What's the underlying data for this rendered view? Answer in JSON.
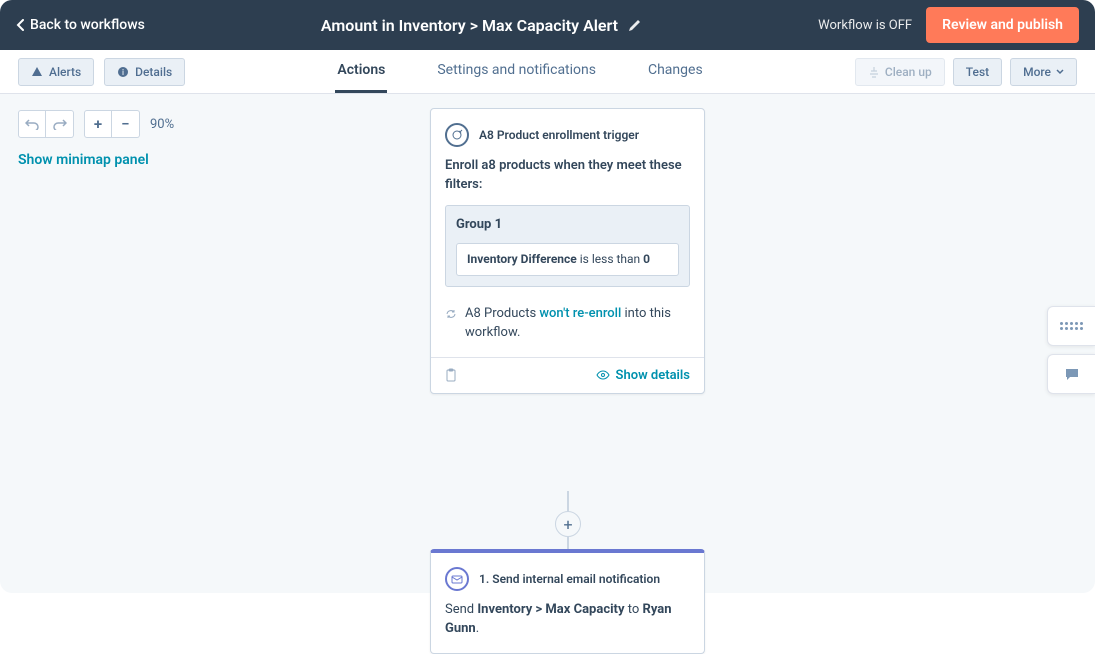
{
  "topbar": {
    "back": "Back to workflows",
    "title": "Amount in Inventory > Max Capacity Alert",
    "status": "Workflow is OFF",
    "review": "Review and publish"
  },
  "nav": {
    "alerts": "Alerts",
    "details": "Details",
    "tabs": {
      "actions": "Actions",
      "settings": "Settings and notifications",
      "changes": "Changes"
    },
    "cleanup": "Clean up",
    "test": "Test",
    "more": "More"
  },
  "tools": {
    "zoom": "90%",
    "minimap": "Show minimap panel"
  },
  "trigger": {
    "title": "A8 Product enrollment trigger",
    "intro": "Enroll a8 products when they meet these filters:",
    "group_label": "Group 1",
    "field": "Inventory Difference",
    "op": " is less than ",
    "value": "0",
    "reenroll_prefix": "A8 Products ",
    "reenroll_link": "won't re-enroll",
    "reenroll_suffix": " into this workflow.",
    "show_details": "Show details"
  },
  "action1": {
    "title": "1. Send internal email notification",
    "prefix": "Send ",
    "subject": "Inventory > Max Capacity",
    "mid": " to ",
    "recipient": "Ryan Gunn",
    "end": "."
  }
}
